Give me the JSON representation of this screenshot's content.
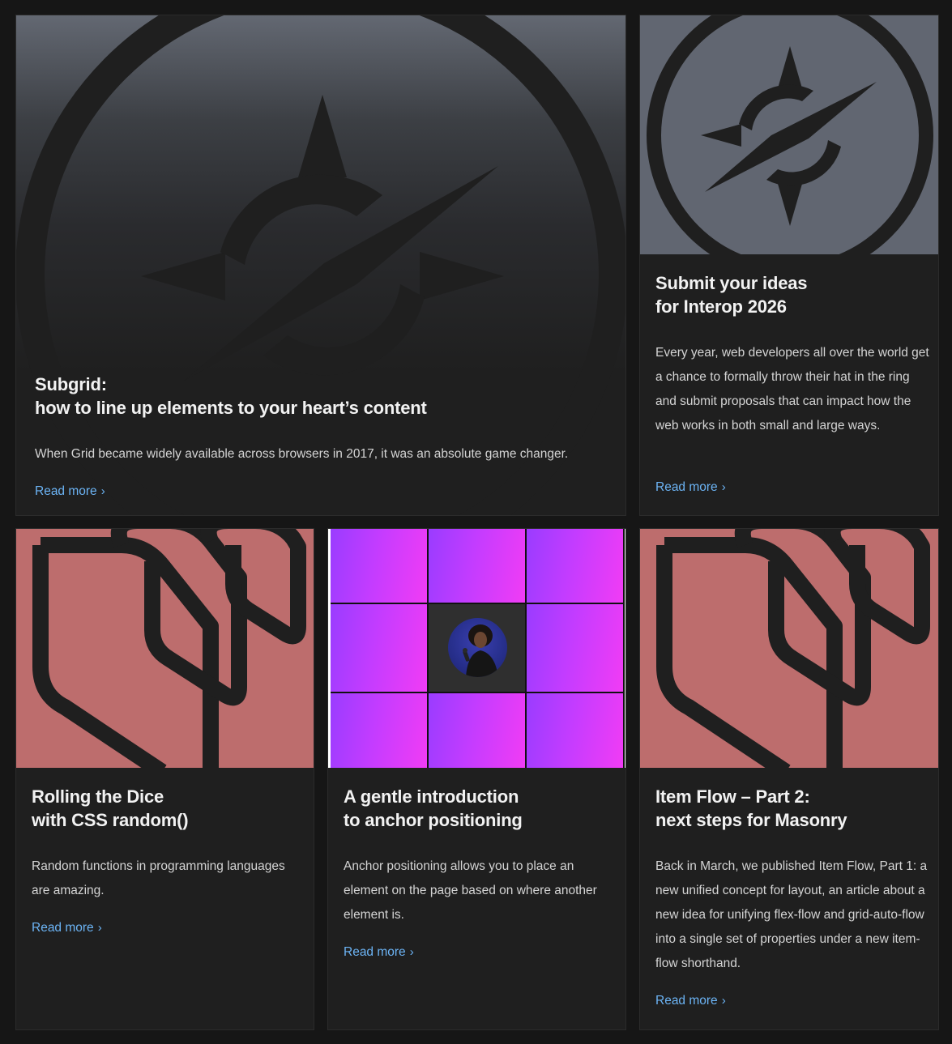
{
  "colors": {
    "page_background": "#161616",
    "card_background": "#1f1f1f",
    "link": "#6cb4f5",
    "compass_slate": "#616671",
    "masonry_rose": "#bd6d6d",
    "anchor_gradient_start": "#9a3cff",
    "anchor_gradient_end": "#f13cf5"
  },
  "cards": [
    {
      "title_lines": [
        "Subgrid:",
        "how to line up elements to your heart’s content"
      ],
      "excerpt": "When Grid became widely available across browsers in 2017, it was an absolute game changer.",
      "read_more": "Read more",
      "image": "compass-logo"
    },
    {
      "title_lines": [
        "Submit your ideas",
        "for Interop 2026"
      ],
      "excerpt": "Every year, web developers all over the world get a chance to formally throw their hat in the ring and submit proposals that can impact how the web works in both small and large ways.",
      "read_more": "Read more",
      "image": "compass-logo"
    },
    {
      "title_lines": [
        "Rolling the Dice",
        "with CSS random()"
      ],
      "excerpt": "Random functions in programming languages are amazing.",
      "read_more": "Read more",
      "image": "masonry-stacked-shapes"
    },
    {
      "title_lines": [
        "A gentle introduction",
        "to anchor positioning"
      ],
      "excerpt": "Anchor positioning allows you to place an element on the page based on where another element is.",
      "read_more": "Read more",
      "image": "anchor-grid-with-avatar"
    },
    {
      "title_lines": [
        "Item Flow – Part 2:",
        "next steps for Masonry"
      ],
      "excerpt": "Back in March, we published Item Flow, Part 1: a new unified concept for layout, an article about a new idea for unifying flex-flow and grid-auto-flow into a single set of properties under a new item-flow shorthand.",
      "read_more": "Read more",
      "image": "masonry-stacked-shapes"
    }
  ],
  "icons": {
    "read_more_chevron": "›"
  }
}
